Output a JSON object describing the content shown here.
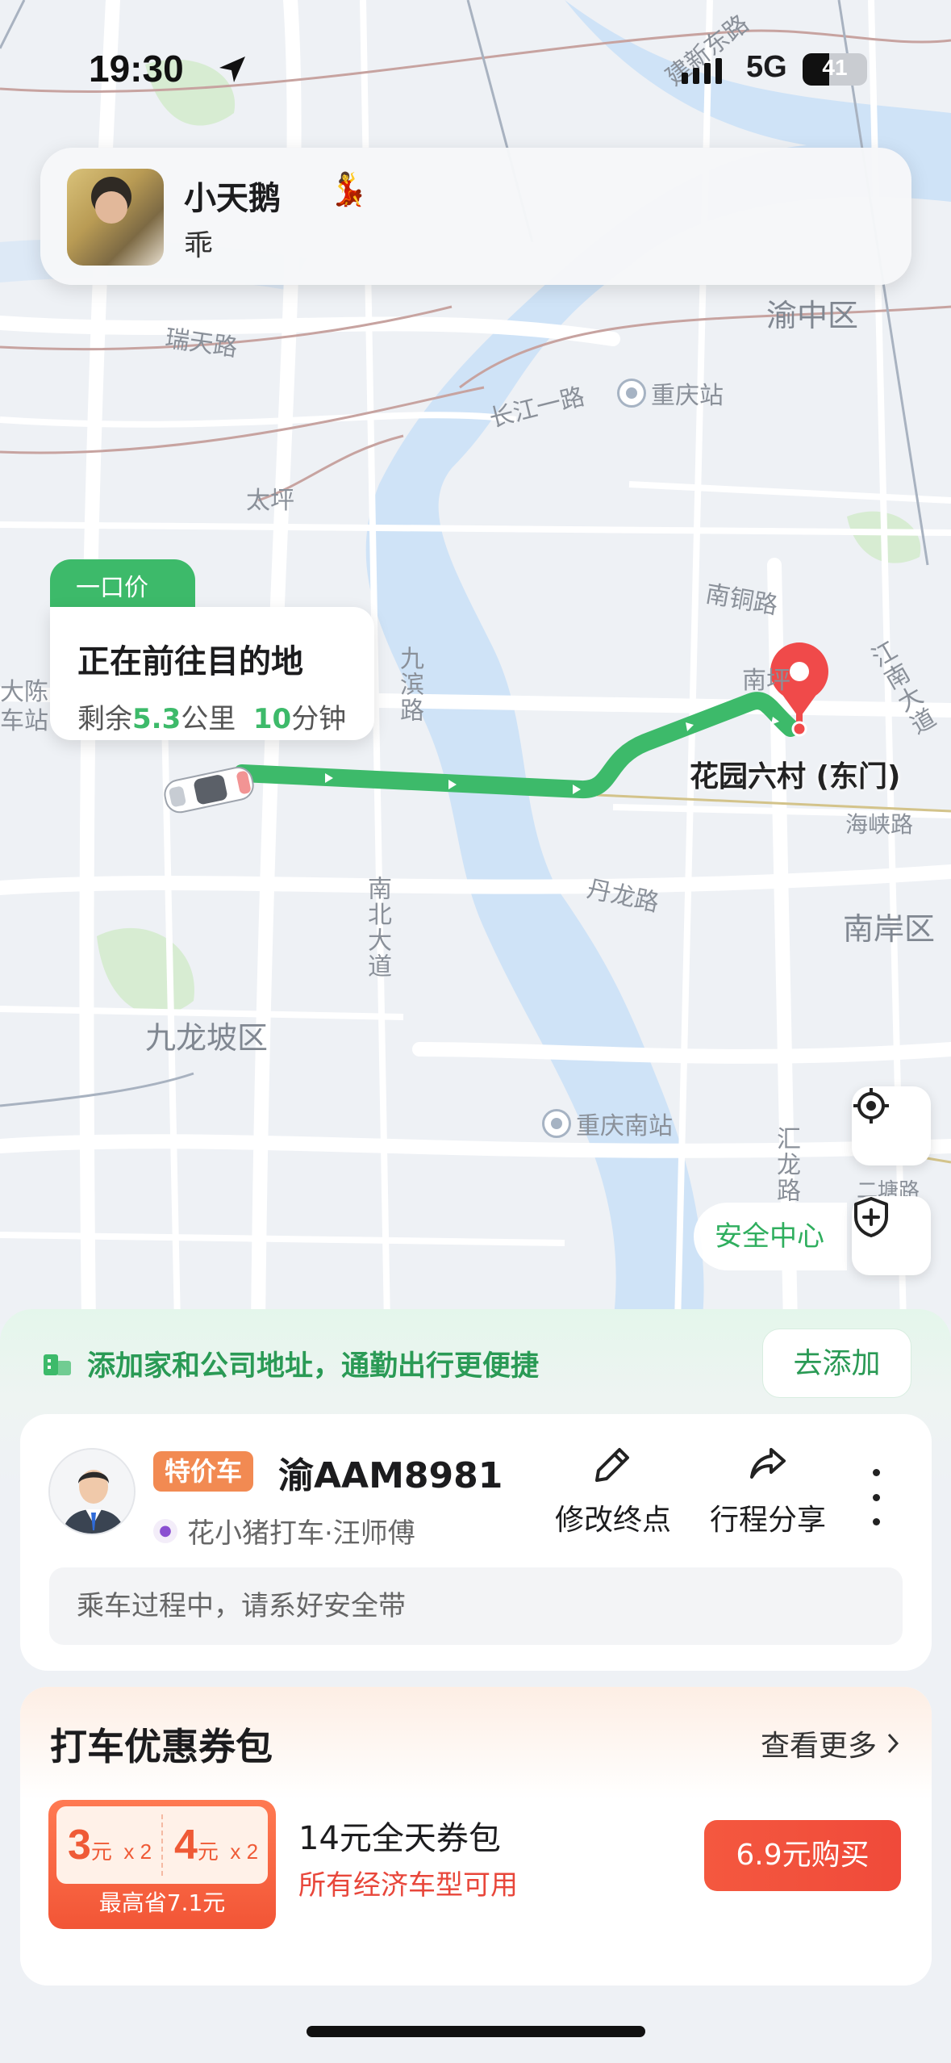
{
  "status_bar": {
    "time": "19:30",
    "network": "5G",
    "battery": "41",
    "battery_level": 0.41
  },
  "notification": {
    "sender": "小天鹅",
    "message": "乖"
  },
  "map": {
    "labels": {
      "jianxin_east_road": "建新东路",
      "yuzhong_district": "渝中区",
      "ruitian_road": "瑞天路",
      "changjiang_1st_road": "长江一路",
      "chongqing_station": "重庆站",
      "taiping": "太坪",
      "nantong_road": "南铜路",
      "jiubin_road": "九滨路",
      "dachen_station": "大陈车站",
      "nanping": "南坪",
      "jiangnan_avenue": "江南大道",
      "haixia_road": "海峡路",
      "danlong_road": "丹龙路",
      "nanbei_avenue": "南北大道",
      "nanan_district": "南岸区",
      "jiulongpo_district": "九龙坡区",
      "chongqing_south_station": "重庆南站",
      "huilong_road": "汇龙路",
      "erjie_road": "二塘路"
    },
    "price_tag": "一口价",
    "route_status": "正在前往目的地",
    "remaining_prefix": "剩余",
    "remaining_distance": "5.3",
    "distance_unit": "公里",
    "remaining_time": "10",
    "time_unit": "分钟",
    "destination": "花园六村 (东门)",
    "safety_center": "安全中心",
    "route_color": "#3dba6a",
    "pin_color": "#f04a4a"
  },
  "banner": {
    "text": "添加家和公司地址，通勤出行更便捷",
    "button": "去添加"
  },
  "driver": {
    "car_type": "特价车",
    "plate": "渝AAM8981",
    "company": "花小猪打车·汪师傅",
    "actions": {
      "edit_destination": "修改终点",
      "share_trip": "行程分享"
    },
    "tip": "乘车过程中，请系好安全带"
  },
  "coupons": {
    "title": "打车优惠券包",
    "more": "查看更多",
    "coupon_a_value": "3",
    "coupon_a_unit": "元",
    "coupon_a_count": "x 2",
    "coupon_b_value": "4",
    "coupon_b_unit": "元",
    "coupon_b_count": "x 2",
    "max_save": "最高省7.1元",
    "pack_name": "14元全天券包",
    "pack_desc": "所有经济车型可用",
    "buy_button": "6.9元购买"
  }
}
